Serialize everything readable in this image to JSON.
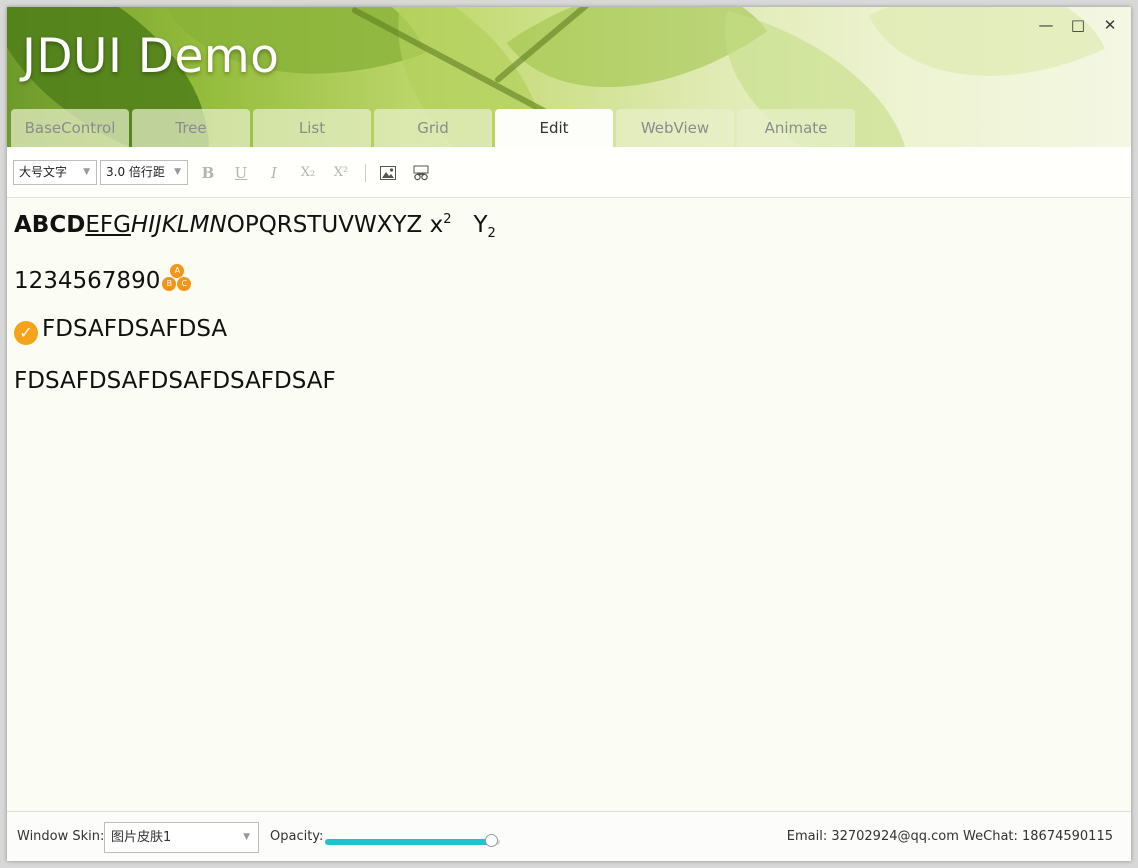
{
  "window": {
    "title": "JDUI Demo",
    "controls": {
      "minimize": "—",
      "maximize": "□",
      "close": "✕"
    }
  },
  "tabs": [
    {
      "label": "BaseControl",
      "active": false
    },
    {
      "label": "Tree",
      "active": false
    },
    {
      "label": "List",
      "active": false
    },
    {
      "label": "Grid",
      "active": false
    },
    {
      "label": "Edit",
      "active": true
    },
    {
      "label": "WebView",
      "active": false
    },
    {
      "label": "Animate",
      "active": false
    }
  ],
  "toolbar": {
    "font_size": "大号文字",
    "line_spacing": "3.0 倍行距",
    "bold": "B",
    "underline": "U",
    "italic": "I",
    "subscript": "X₂",
    "superscript": "X²",
    "insert_image": "image-icon",
    "insert_special": "special-icon"
  },
  "editor": {
    "line1": {
      "bold": "ABCD",
      "underline": "EFG",
      "italic": "HIJKLMN",
      "normal": "OPQRSTUVWXYZ x",
      "sup": "2",
      "mid": "   Y",
      "sub": "2"
    },
    "line2": {
      "text": "1234567890",
      "badge": [
        "A",
        "B",
        "C"
      ]
    },
    "line3": {
      "text": "FDSAFDSAFDSA"
    },
    "line4": {
      "text": "FDSAFDSAFDSAFDSAFDSAF"
    }
  },
  "statusbar": {
    "skin_label": "Window Skin:",
    "skin_value": "图片皮肤1",
    "opacity_label": "Opacity:",
    "opacity_value": 0.95,
    "contact": "Email: 32702924@qq.com WeChat: 18674590115"
  },
  "colors": {
    "accent": "#1fc3cf",
    "badge": "#f2951b",
    "check": "#f7a21b"
  }
}
